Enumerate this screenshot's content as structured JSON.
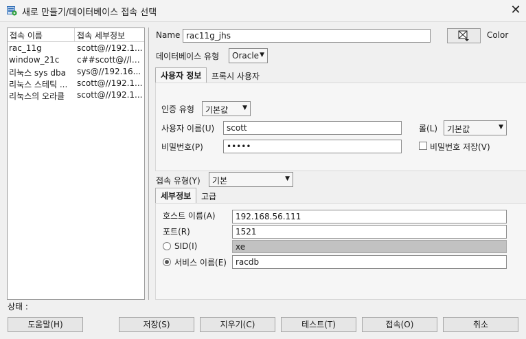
{
  "window": {
    "title": "새로 만들기/데이터베이스 접속 선택",
    "close_glyph": "✕"
  },
  "connections": {
    "headers": [
      "접속 이름",
      "접속 세부정보"
    ],
    "rows": [
      {
        "name": "rac_11g",
        "detail": "scott@//192.1..."
      },
      {
        "name": "window_21c",
        "detail": "c##scott@//lo..."
      },
      {
        "name": "리눅스 sys dba",
        "detail": "sys@//192.16..."
      },
      {
        "name": "리눅스 스테틱 ...",
        "detail": "scott@//192.1..."
      },
      {
        "name": "리눅스의 오라클",
        "detail": "scott@//192.1..."
      }
    ]
  },
  "form": {
    "name_label": "Name",
    "name_value": "rac11g_jhs",
    "color_label": "Color",
    "db_type_label": "데이터베이스 유형",
    "db_type_value": "Oracle",
    "tabs": [
      "사용자 정보",
      "프록시 사용자"
    ],
    "auth_type_label": "인증 유형",
    "auth_type_value": "기본값",
    "username_label": "사용자 이름(U)",
    "username_value": "scott",
    "role_label": "롤(L)",
    "role_value": "기본값",
    "password_label": "비밀번호(P)",
    "password_value": "•••••",
    "save_password_label": "비밀번호 저장(V)",
    "conn_type_label": "접속 유형(Y)",
    "conn_type_value": "기본",
    "detail_tabs": [
      "세부정보",
      "고급"
    ],
    "host_label": "호스트 이름(A)",
    "host_value": "192.168.56.111",
    "port_label": "포트(R)",
    "port_value": "1521",
    "sid_label": "SID(I)",
    "sid_value": "xe",
    "service_label": "서비스 이름(E)",
    "service_value": "racdb"
  },
  "status_label": "상태 :",
  "buttons": {
    "help": "도움말(H)",
    "save": "저장(S)",
    "clear": "지우기(C)",
    "test": "테스트(T)",
    "connect": "접속(O)",
    "cancel": "취소"
  },
  "colors": {
    "list_border": "#9b9b9b",
    "disabled_field": "#c2c2c2",
    "icon_green": "#2e9e3e",
    "icon_blue": "#2f6db5"
  }
}
